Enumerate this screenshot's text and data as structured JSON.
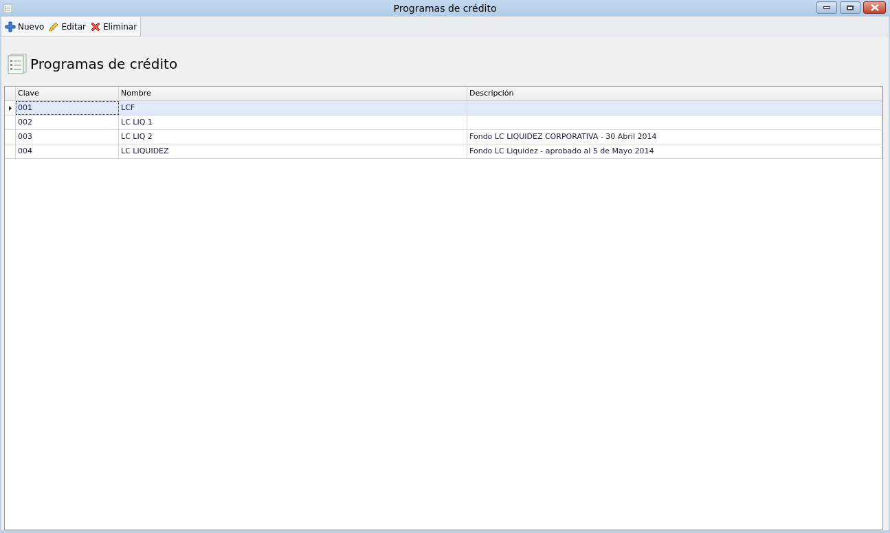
{
  "window": {
    "title": "Programas de crédito"
  },
  "toolbar": [
    {
      "kind": "add",
      "label": "Nuevo"
    },
    {
      "kind": "edit",
      "label": "Editar"
    },
    {
      "kind": "delete",
      "label": "Eliminar"
    }
  ],
  "heading": "Programas de crédito",
  "table": {
    "columns": [
      "Clave",
      "Nombre",
      "Descripción"
    ],
    "rows": [
      {
        "selected": true,
        "cells": [
          "001",
          "LCF",
          null
        ]
      },
      {
        "selected": false,
        "cells": [
          "002",
          "LC LIQ 1",
          null
        ]
      },
      {
        "selected": false,
        "cells": [
          "003",
          "LC LIQ 2",
          "Fondo LC LIQUIDEZ CORPORATIVA - 30 Abril 2014"
        ]
      },
      {
        "selected": false,
        "cells": [
          "004",
          "LC LIQUIDEZ",
          "Fondo LC Liquidez - aprobado al 5 de Mayo 2014"
        ]
      }
    ]
  }
}
